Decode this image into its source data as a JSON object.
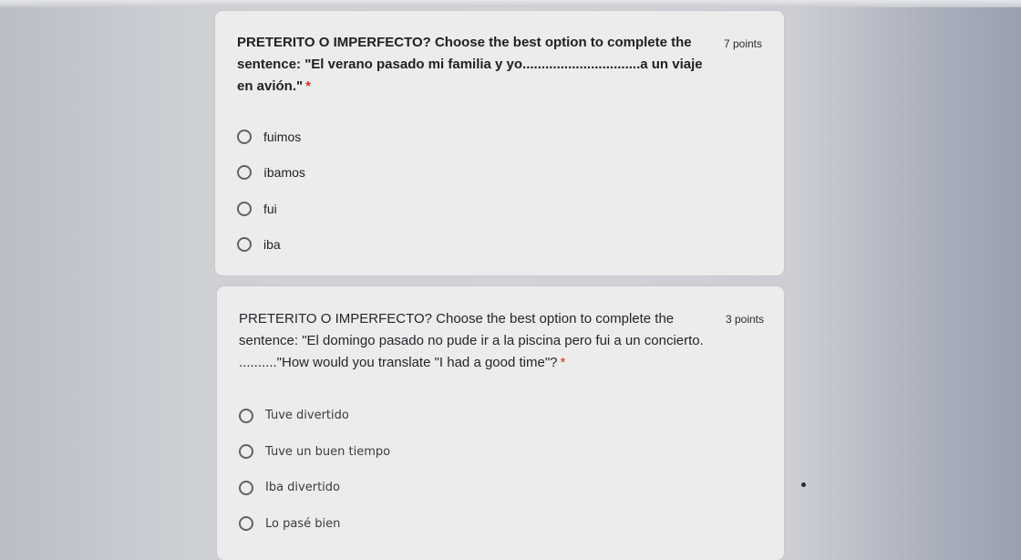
{
  "questions": [
    {
      "text": "PRETERITO O IMPERFECTO? Choose the best option to complete the sentence: \"El verano pasado mi familia y yo...............................a un viaje en avión.\"",
      "required_marker": "*",
      "points": "7 points",
      "options": [
        "fuimos",
        "íbamos",
        "fui",
        "iba"
      ]
    },
    {
      "text": "PRETERITO O IMPERFECTO? Choose the best option to complete the sentence: \"El domingo pasado no pude ir a la piscina pero fui a un concierto. ..........\"How would you translate \"I had a good time\"?",
      "required_marker": "*",
      "points": "3 points",
      "options": [
        "Tuve divertido",
        "Tuve un buen tiempo",
        "Iba divertido",
        "Lo pasé bien"
      ]
    }
  ]
}
